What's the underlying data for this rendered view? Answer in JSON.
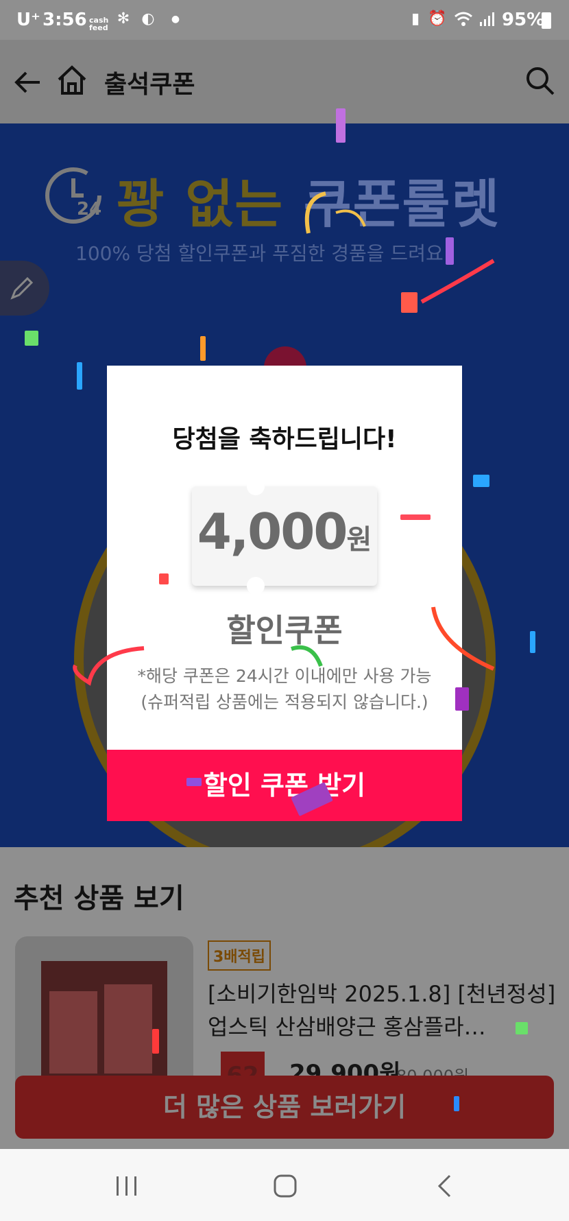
{
  "status_bar": {
    "carrier": "U⁺",
    "time": "3:56",
    "cashfeed": "cash feed",
    "battery": "95%"
  },
  "header": {
    "title": "출석쿠폰"
  },
  "banner": {
    "headline_part1": "꽝 없는",
    "headline_part2": "쿠폰룰렛",
    "subtitle": "100% 당첨 할인쿠폰과 푸짐한 경품을 드려요!",
    "clock_badge": "24"
  },
  "modal": {
    "title": "당첨을 축하드립니다!",
    "amount": "4,000",
    "currency": "원",
    "coupon_label": "할인쿠폰",
    "note_line1": "*해당 쿠폰은 24시간 이내에만 사용 가능",
    "note_line2": "(슈퍼적립 상품에는 적용되지 않습니다.)",
    "button": "할인 쿠폰 받기"
  },
  "recommend": {
    "section_title": "추천 상품 보기",
    "product": {
      "badge": "3배적립",
      "title": "[소비기한임박 2025.1.8] [천년정성] 업스틱 산삼배양근 홍삼플라…",
      "discount": "62",
      "price": "29,900원",
      "original_price": "80,000원"
    },
    "more_button": "더 많은 상품 보러가기"
  },
  "colors": {
    "accent": "#ff0f4f",
    "banner_bg": "#0f2a6a"
  }
}
